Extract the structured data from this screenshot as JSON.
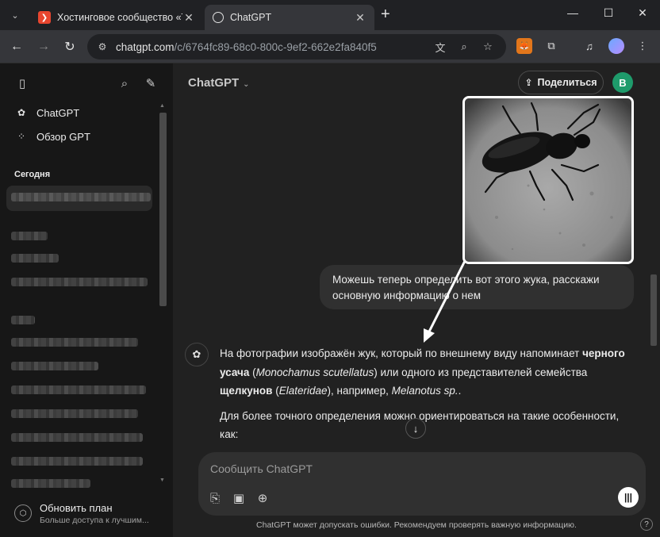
{
  "browser": {
    "tabs": [
      {
        "title": "Хостинговое сообщество «Tim",
        "close": "✕"
      },
      {
        "title": "ChatGPT",
        "close": "✕"
      }
    ],
    "new_tab": "+",
    "url_host": "chatgpt.com",
    "url_path": "/c/6764fc89-68c0-800c-9ef2-662e2fa840f5",
    "window_controls": {
      "minimize": "—",
      "maximize": "☐",
      "close": "✕"
    }
  },
  "sidebar": {
    "items": [
      {
        "label": "ChatGPT",
        "icon": "chatgpt-logo-icon"
      },
      {
        "label": "Обзор GPT",
        "icon": "grid-icon"
      }
    ],
    "section_title": "Сегодня",
    "upgrade_title": "Обновить план",
    "upgrade_subtitle": "Больше доступа к лучшим..."
  },
  "header": {
    "model": "ChatGPT",
    "share_label": "Поделиться",
    "avatar_letter": "B"
  },
  "conversation": {
    "user_message": "Можешь теперь определить вот этого жука, расскажи основную информацию о нем",
    "answer_p1_a": "На фотографии изображён жук, который по внешнему виду напоминает ",
    "answer_p1_b": "черного усача",
    "answer_p1_c": " (",
    "answer_p1_d": "Monochamus scutellatus",
    "answer_p1_e": ") или одного из представителей семейства ",
    "answer_p1_f": "щелкунов",
    "answer_p1_g": " (",
    "answer_p1_h": "Elateridae",
    "answer_p1_i": "), например, ",
    "answer_p1_j": "Melanotus sp.",
    "answer_p1_k": ".",
    "answer_p2": "Для более точного определения можно ориентироваться на такие особенности, как:"
  },
  "composer": {
    "placeholder": "Сообщить ChatGPT",
    "disclaimer": "ChatGPT может допускать ошибки. Рекомендуем проверять важную информацию.",
    "help": "?"
  },
  "colors": {
    "accent_avatar": "#1e9b6b",
    "annotation_arrow": "#ffffff",
    "tab_favicon": "#e8462f"
  }
}
